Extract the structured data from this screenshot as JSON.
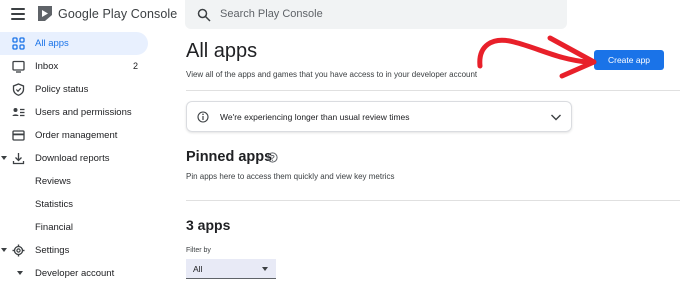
{
  "header": {
    "menu_icon": "hamburger-menu-icon",
    "brand_name": "Google Play Console",
    "search_placeholder": "Search Play Console"
  },
  "sidebar": {
    "items": [
      {
        "label": "All apps",
        "icon": "apps-grid-icon",
        "active": true
      },
      {
        "label": "Inbox",
        "icon": "inbox-icon",
        "badge": "2"
      },
      {
        "label": "Policy status",
        "icon": "shield-icon"
      },
      {
        "label": "Users and permissions",
        "icon": "users-list-icon"
      },
      {
        "label": "Order management",
        "icon": "credit-card-icon"
      },
      {
        "label": "Download reports",
        "icon": "download-icon",
        "expandable": true
      },
      {
        "label": "Reviews"
      },
      {
        "label": "Statistics"
      },
      {
        "label": "Financial"
      },
      {
        "label": "Settings",
        "icon": "gear-icon",
        "expandable": true
      },
      {
        "label": "Developer account",
        "expandable": true
      }
    ]
  },
  "main": {
    "title": "All apps",
    "description": "View all of the apps and games that you have access to in your developer account",
    "create_button": "Create app",
    "notice": "We're experiencing longer than usual review times",
    "pinned_title": "Pinned apps",
    "pinned_description": "Pin apps here to access them quickly and view key metrics",
    "apps_count": "3 apps",
    "filter_label": "Filter by",
    "filter_value": "All"
  },
  "colors": {
    "accent": "#1a73e8",
    "active_nav_bg": "#e8f0fe",
    "annotation_arrow": "#e8202a"
  }
}
